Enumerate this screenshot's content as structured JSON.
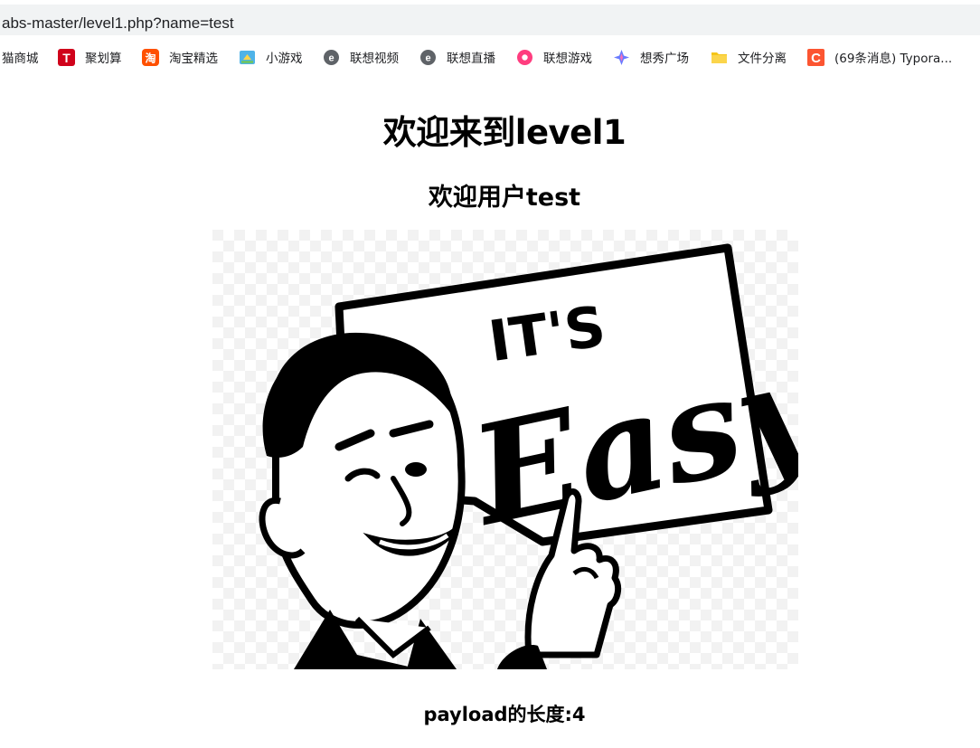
{
  "browser": {
    "url": "abs-master/level1.php?name=test"
  },
  "bookmarks": [
    {
      "label": "猫商城",
      "icon": "tmall-icon"
    },
    {
      "label": "聚划算",
      "icon": "juhuasuan-icon"
    },
    {
      "label": "淘宝精选",
      "icon": "taobao-icon"
    },
    {
      "label": "小游戏",
      "icon": "mini-game-icon"
    },
    {
      "label": "联想视频",
      "icon": "lenovo-video-icon"
    },
    {
      "label": "联想直播",
      "icon": "lenovo-live-icon"
    },
    {
      "label": "联想游戏",
      "icon": "lenovo-game-icon"
    },
    {
      "label": "想秀广场",
      "icon": "xiangxiu-icon"
    },
    {
      "label": "文件分离",
      "icon": "folder-icon"
    },
    {
      "label": "(69条消息) Typora...",
      "icon": "csdn-icon"
    }
  ],
  "page": {
    "title": "欢迎来到level1",
    "welcome": "欢迎用户test",
    "image_text_top": "IT'S",
    "image_text_main": "Easy",
    "payload_length": "payload的长度:4"
  },
  "colors": {
    "juhuasuan": "#d0021b",
    "taobao": "#ff5000",
    "lenovo_gray": "#5f6368",
    "lenovo_game": "#ff3d7f",
    "folder": "#f5c518",
    "csdn": "#fc5531"
  }
}
